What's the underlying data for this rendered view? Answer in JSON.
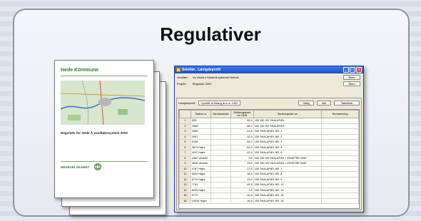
{
  "title": "Regulativer",
  "report_cover": {
    "municipality": "Hede Kommune",
    "subtitle": "Regulativ for Hede Å vandløbssystem 2003",
    "publisher": "HEDESELSKABET"
  },
  "window": {
    "title": "Selvtlør.. Længdeprofil",
    "vandlob_label": "Vandløb :",
    "vandlob_value": "Vy struktur Studerå-systemet Nærså",
    "projekt_label": "Projekt :",
    "projekt_value": "Regulativ 2001",
    "aben1": "Åben",
    "aben2": "Åben",
    "tabs": [
      "Tabel",
      "Bemærkning"
    ],
    "profile_label": "Længdeprofil",
    "profile_value": "Opmålt af tilbørg ann nr 1992",
    "buttons": {
      "vaelg": "Vælg",
      "info": "Info",
      "tabelfare": "Tabelfare"
    },
    "columns": [
      "",
      "Station m",
      "Vandløbsside",
      "Skråningskant cm DNN",
      "Skråningside cm",
      "Bemærkning"
    ],
    "rows": [
      [
        "1",
        "525",
        "",
        "45,0",
        "150 150 OH SKALAPÆL",
        ""
      ],
      [
        "2",
        "1966",
        "",
        "-28,2",
        "150 150 OH SKALAPÆL",
        ""
      ],
      [
        "3",
        "2066",
        "",
        "-24,5",
        "150 SKALAPÆL NR. 1",
        ""
      ],
      [
        "4",
        "2057",
        "",
        "-32,0",
        "150 SKALAPÆL NR. 2",
        ""
      ],
      [
        "5",
        "3136",
        "",
        "-55,0",
        "150 SKALAPÆL NR. 3",
        ""
      ],
      [
        "6",
        "3673 Højre",
        "",
        "-52,0",
        "150 SKALAPÆL NR. 4",
        ""
      ],
      [
        "7",
        "4247 Højre",
        "",
        "-12,0",
        "150 SKALAPÆL NR. 6",
        ""
      ],
      [
        "8",
        "4462 Venstre",
        "",
        "9,6",
        "150 150 OH SKALAPÆL I VENSTRE SIDE",
        ""
      ],
      [
        "9",
        "4526 Venstre",
        "",
        "23,0",
        "150 150 OH SKALAPÆL I VENSTRE SIDE",
        ""
      ],
      [
        "10",
        "4787 Højre",
        "",
        "27,0",
        "150 SKALAPÆL NR. 7",
        ""
      ],
      [
        "11",
        "5262 Højre",
        "",
        "38,5",
        "150 SKALAPÆL NR. 8",
        ""
      ],
      [
        "12",
        "5779 Højre",
        "",
        "23,0",
        "150 SKALAPÆL NR. 9",
        ""
      ],
      [
        "13",
        "7761",
        "",
        "-49,5",
        "150 SKALAPÆL NR. 13",
        ""
      ],
      [
        "14",
        "8236 Højre",
        "",
        "1,6",
        "150 SKALAPÆL NR. 14",
        ""
      ],
      [
        "15",
        "9772",
        "",
        "-10,5",
        "150 SKALAPÆL NR. 15",
        ""
      ],
      [
        "16",
        "10324 Højre",
        "",
        "16,5",
        "150 SKALAPÆL NR. 16",
        ""
      ]
    ]
  }
}
